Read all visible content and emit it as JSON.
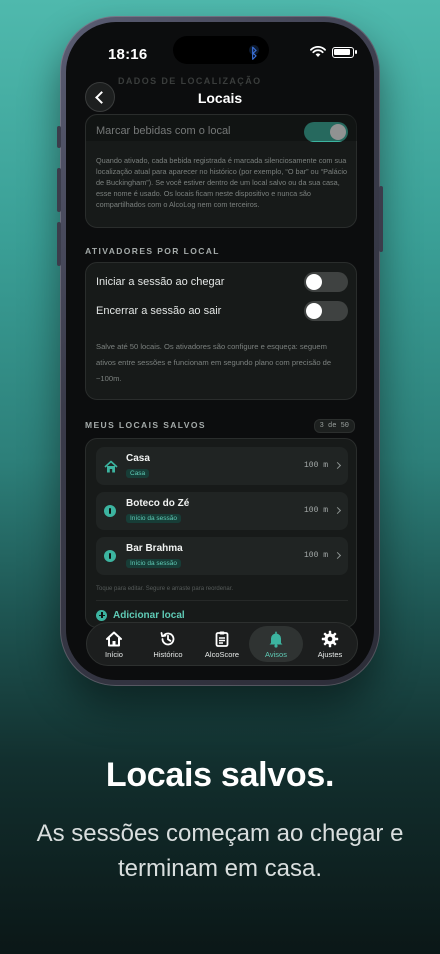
{
  "status": {
    "time": "18:16",
    "bluetooth_glyph": "ᛒ"
  },
  "nav": {
    "title": "Locais",
    "faded_section": "DADOS DE LOCALIZAÇÃO"
  },
  "location_tracking": {
    "label": "Marcar bebidas com o local",
    "enabled": true,
    "description": "Quando ativado, cada bebida registrada é marcada silenciosamente com sua localização atual para aparecer no histórico (por exemplo, “O bar” ou “Palácio de Buckingham”). Se você estiver dentro de um local salvo ou da sua casa, esse nome é usado. Os locais ficam neste dispositivo e nunca são compartilhados com o AlcoLog nem com terceiros."
  },
  "triggers": {
    "section_title": "ATIVADORES POR LOCAL",
    "start_label": "Iniciar a sessão ao chegar",
    "start_enabled": false,
    "end_label": "Encerrar a sessão ao sair",
    "end_enabled": false,
    "description": "Salve até 50 locais. Os ativadores são configure e esqueça: seguem ativos entre sessões e funcionam em segundo plano com precisão de ~100m."
  },
  "saved_locations": {
    "section_title": "MEUS LOCAIS SALVOS",
    "count_label": "3 de 50",
    "items": [
      {
        "name": "Casa",
        "tag": "Casa",
        "radius": "100 m",
        "icon": "house-icon"
      },
      {
        "name": "Boteco do Zé",
        "tag": "Início da sessão",
        "radius": "100 m",
        "icon": "pin-icon"
      },
      {
        "name": "Bar Brahma",
        "tag": "Início da sessão",
        "radius": "100 m",
        "icon": "pin-icon"
      }
    ],
    "hint": "Toque para editar. Segure e arraste para reordenar.",
    "add_label": "Adicionar local"
  },
  "tabbar": {
    "active": "Avisos",
    "items": [
      {
        "label": "Início",
        "icon": "home-icon"
      },
      {
        "label": "Histórico",
        "icon": "history-icon"
      },
      {
        "label": "AlcoScore",
        "icon": "clipboard-icon"
      },
      {
        "label": "Avisos",
        "icon": "bell-icon"
      },
      {
        "label": "Ajustes",
        "icon": "gear-icon"
      }
    ]
  },
  "marketing": {
    "headline": "Locais salvos.",
    "subline": "As sessões começam ao chegar e terminam em casa."
  },
  "colors": {
    "accent": "#3cb4a0",
    "background": "#0c0d0e",
    "card": "#171a19"
  }
}
